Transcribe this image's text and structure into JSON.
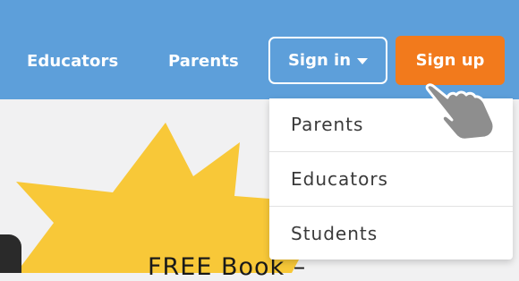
{
  "header": {
    "nav": [
      {
        "label": "Educators"
      },
      {
        "label": "Parents"
      }
    ],
    "sign_in_label": "Sign in",
    "sign_up_label": "Sign up"
  },
  "dropdown": {
    "items": [
      {
        "label": "Parents"
      },
      {
        "label": "Educators"
      },
      {
        "label": "Students"
      }
    ]
  },
  "promo": {
    "title": "FREE Book –"
  },
  "colors": {
    "header_bg": "#5d9fda",
    "signup_bg": "#f27a1c",
    "burst": "#f8c838",
    "page_bg": "#f1f1f2"
  },
  "icons": {
    "sign_in_caret": "caret-down-icon",
    "cursor": "hand-pointer-icon"
  }
}
